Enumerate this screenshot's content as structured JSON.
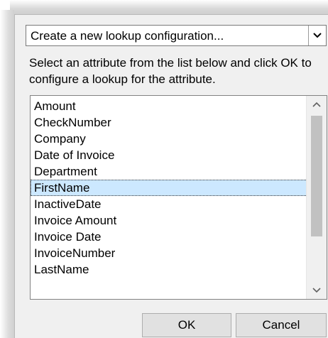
{
  "combo": {
    "value": "Create a new lookup configuration..."
  },
  "instructions": "Select an attribute from the list below and click OK to configure a lookup for the attribute.",
  "attributes": {
    "items": [
      "Amount",
      "CheckNumber",
      "Company",
      "Date of Invoice",
      "Department",
      "FirstName",
      "InactiveDate",
      "Invoice Amount",
      "Invoice Date",
      "InvoiceNumber",
      "LastName"
    ],
    "selected": "FirstName"
  },
  "buttons": {
    "ok_label": "OK",
    "cancel_label": "Cancel"
  },
  "colors": {
    "selection": "#cce8ff",
    "dialog_bg": "#f0f0f0",
    "button_bg": "#e1e1e1"
  }
}
